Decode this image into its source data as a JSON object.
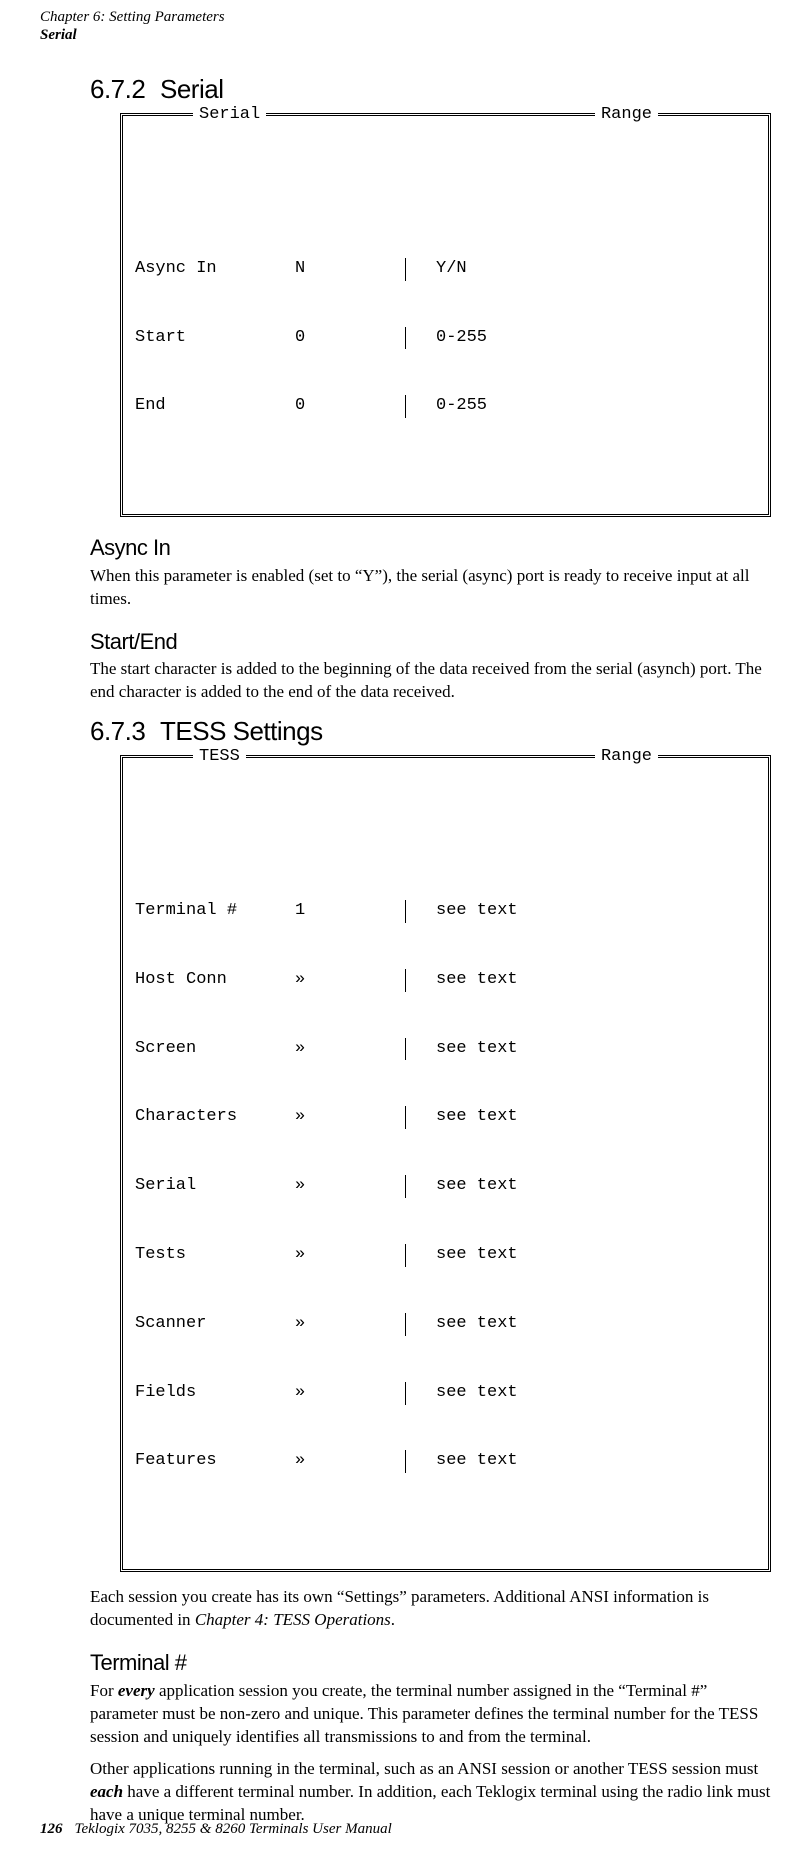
{
  "runhead": {
    "chapter": "Chapter  6:  Setting Parameters",
    "section": "Serial"
  },
  "s672": {
    "num": "6.7.2",
    "title": "Serial",
    "box": {
      "label_left": "Serial",
      "label_right": "Range",
      "rows": [
        {
          "name": "Async In",
          "val": "N",
          "range": "Y/N"
        },
        {
          "name": "Start",
          "val": "0",
          "range": "0-255"
        },
        {
          "name": "End",
          "val": "0",
          "range": "0-255"
        }
      ]
    },
    "async_head": "Async In",
    "async_body": "When this parameter is enabled (set to “Y”), the serial (async) port is ready to receive input at all times.",
    "startend_head": "Start/End",
    "startend_body": "The start character is added to the beginning of the data received from the serial (asynch) port. The end character is added to the end of the data received."
  },
  "s673": {
    "num": "6.7.3",
    "title": "TESS Settings",
    "box": {
      "label_left": "TESS",
      "label_right": "Range",
      "rows": [
        {
          "name": "Terminal #",
          "val": "1",
          "range": "see text"
        },
        {
          "name": "Host Conn",
          "val": "»",
          "range": "see text"
        },
        {
          "name": "Screen",
          "val": "»",
          "range": "see text"
        },
        {
          "name": "Characters",
          "val": "»",
          "range": "see text"
        },
        {
          "name": "Serial",
          "val": "»",
          "range": "see text"
        },
        {
          "name": "Tests",
          "val": "»",
          "range": "see text"
        },
        {
          "name": "Scanner",
          "val": "»",
          "range": "see text"
        },
        {
          "name": "Fields",
          "val": "»",
          "range": "see text"
        },
        {
          "name": "Features",
          "val": "»",
          "range": "see text"
        }
      ]
    },
    "intro": "Each session you create has its own “Settings” parameters. Additional ANSI information is documented in ",
    "intro_ital": "Chapter 4: TESS Operations",
    "intro_tail": ".",
    "term_head": "Terminal #",
    "term_p1_a": "For ",
    "term_p1_em": "every",
    "term_p1_b": " application session you create, the terminal number assigned in the “Terminal #” parameter must be non-zero and unique. This parameter defines the terminal number for the TESS session and uniquely identifies all transmissions to and from the terminal.",
    "term_p2_a": "Other applications running in the terminal, such as an ANSI session or another TESS session must ",
    "term_p2_em": "each",
    "term_p2_b": " have a different terminal number. In addition, each Teklogix terminal using the radio link must have a unique terminal number."
  },
  "footer": {
    "page": "126",
    "book": "Teklogix 7035, 8255 & 8260 Terminals User Manual"
  }
}
